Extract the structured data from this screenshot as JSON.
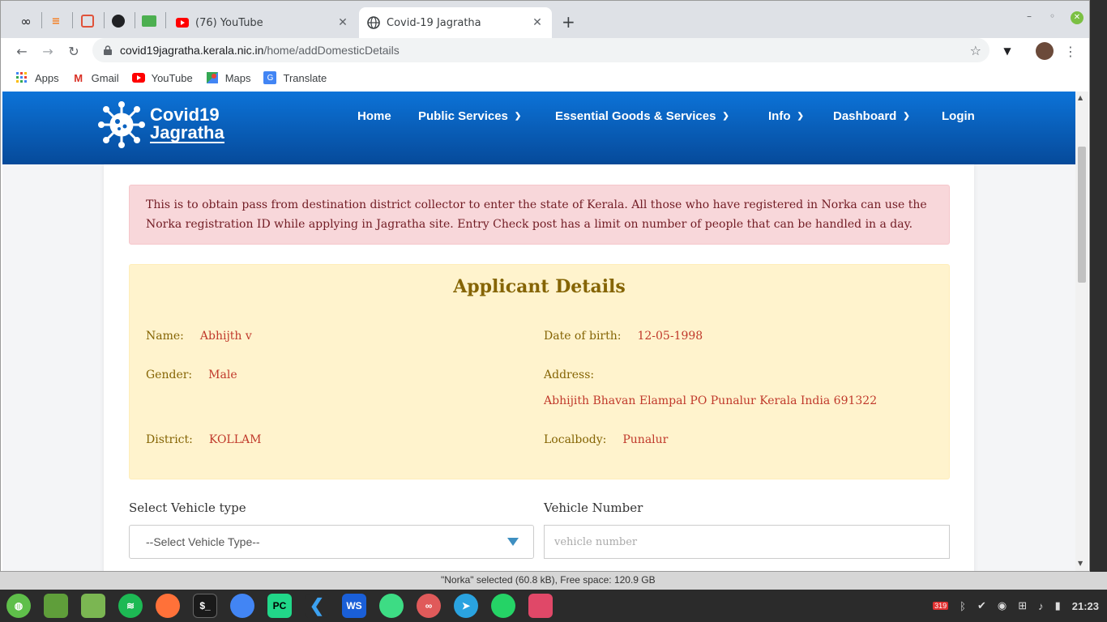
{
  "browser": {
    "tabs": [
      {
        "title": "(76) YouTube",
        "active": false
      },
      {
        "title": "Covid-19 Jagratha",
        "active": true
      }
    ],
    "url_host": "covid19jagratha.kerala.nic.in",
    "url_path": "/home/addDomesticDetails",
    "bookmarks": [
      "Apps",
      "Gmail",
      "YouTube",
      "Maps",
      "Translate"
    ],
    "newtab_glyph": "+",
    "close_glyph": "✕"
  },
  "site": {
    "brand_line1": "Covid19",
    "brand_line2": "Jagratha",
    "menu": {
      "home": "Home",
      "public_services": "Public Services",
      "essential": "Essential Goods & Services",
      "info": "Info",
      "dashboard": "Dashboard",
      "login": "Login"
    },
    "alert_text": "This is to obtain pass from destination district collector to enter the state of Kerala. All those who have registered in Norka can use the Norka registration ID while applying in Jagratha site. Entry Check post has a limit on number of people that can be handled in a day.",
    "details": {
      "title": "Applicant Details",
      "name_label": "Name:",
      "name_value": "Abhijth v",
      "dob_label": "Date of birth:",
      "dob_value": "12-05-1998",
      "gender_label": "Gender:",
      "gender_value": "Male",
      "address_label": "Address:",
      "address_value": "Abhijith Bhavan Elampal PO Punalur Kerala India 691322",
      "district_label": "District:",
      "district_value": "KOLLAM",
      "localbody_label": "Localbody:",
      "localbody_value": "Punalur"
    },
    "form": {
      "vehicle_type_label": "Select Vehicle type",
      "vehicle_type_value": "--Select Vehicle Type--",
      "vehicle_number_label": "Vehicle Number",
      "vehicle_number_placeholder": "vehicle number"
    }
  },
  "behind_window": {
    "status": "\"Norka\" selected (60.8 kB), Free space: 120.9 GB"
  },
  "panel": {
    "badge": "319",
    "clock": "21:23"
  },
  "colors": {
    "nav_top": "#0c73d8",
    "nav_bottom": "#064a9a",
    "alert_bg": "#f8d7da",
    "alert_text": "#721c24",
    "details_bg": "#fff3cd",
    "details_label": "#856404",
    "details_value": "#c0392b"
  }
}
